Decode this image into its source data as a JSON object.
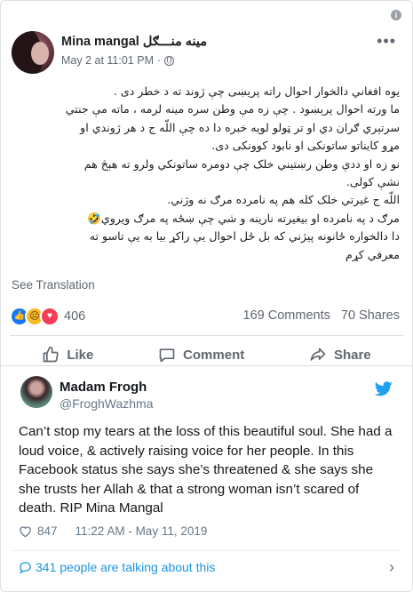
{
  "facebook_post": {
    "author_name": "Mina mangal  مینه منـــګل",
    "date": "May 2 at 11:01 PM",
    "separator": "·",
    "body_lines": [
      "یوه افغاني دالخوار احوال راته پریښی  چې ژوند ته د خطر دی .",
      "ما ورته احوال پرېښود . چې زه مې وطن سره مینه لرمه ، ماته مې جنتي",
      "سرتېري ګران دي او تر ټولو لویه خبره دا ده چې اللّه ج د هر ژوندي او",
      "مړو کایناتو ساتونکی او نابود کوونکی دی.",
      "نو زه  او ددې وطن رښتیني خلک چې دومره ساتونکي ولرو ته هېڅ هم",
      "نشې کولی.",
      "اللّه ج غیرتي خلک کله هم په نامرده مرګ نه وژني.",
      "مرګ د په نامرده او بیغیرته نارینه و شي چې ښځه په مرګ ویروي🤣",
      "دا دالخواره ځانونه پیژني که بل ځل احوال یې راکړ بیا به یې تاسو ته",
      "معرفي کړم"
    ],
    "see_translation": "See Translation",
    "reaction_count": "406",
    "comments": "169 Comments",
    "shares": "70 Shares",
    "actions": {
      "like": "Like",
      "comment": "Comment",
      "share": "Share"
    }
  },
  "tweet": {
    "author_name": "Madam Frogh",
    "handle": "@FroghWazhma",
    "text": "Can’t stop my tears at the loss of this beautiful soul. She had a loud voice, & actively raising voice for her people. In this Facebook status she says she’s threatened & she says she she trusts her Allah & that a strong woman isn’t scared of death. RIP Mina Mangal",
    "likes": "847",
    "timestamp": "11:22 AM - May 11, 2019",
    "footer_link": "341 people are talking about this"
  },
  "colors": {
    "facebook_blue": "#1877f2",
    "twitter_blue": "#1da1f2",
    "love_red": "#f33e58",
    "sad_yellow": "#f7b928"
  },
  "icons": [
    "info-icon",
    "globe-icon",
    "more-icon",
    "like-reaction-icon",
    "sad-reaction-icon",
    "love-reaction-icon",
    "thumbs-up-icon",
    "comment-icon",
    "share-icon",
    "twitter-bird-icon",
    "heart-icon",
    "speech-bubble-icon",
    "chevron-right-icon"
  ]
}
